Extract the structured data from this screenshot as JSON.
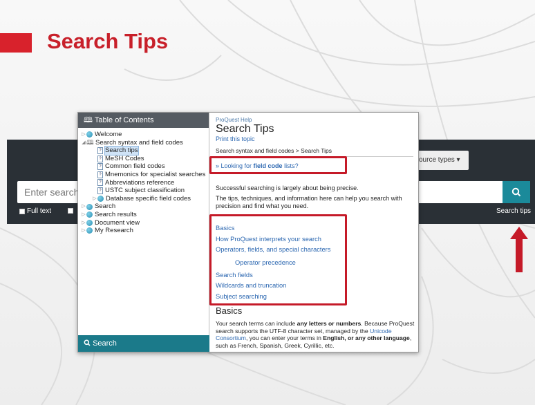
{
  "slide": {
    "title": "Search Tips",
    "accent_color": "#c8202a"
  },
  "background_search": {
    "placeholder": "Enter search",
    "search_icon": "search-icon",
    "source_types_label": "ource types ▾",
    "fulltext_label": "Full text",
    "search_tips_label": "Search tips"
  },
  "help": {
    "toc_header": "Table of Contents",
    "toc_items": [
      {
        "label": "Welcome",
        "icon": "globe-icon",
        "toggle": "▷"
      },
      {
        "label": "Search syntax and field codes",
        "icon": "book-icon",
        "toggle": "◢"
      },
      {
        "label": "Search tips",
        "icon": "page-icon",
        "toggle": ""
      },
      {
        "label": "MeSH Codes",
        "icon": "page-icon",
        "toggle": ""
      },
      {
        "label": "Common field codes",
        "icon": "page-icon",
        "toggle": ""
      },
      {
        "label": "Mnemonics for specialist searches",
        "icon": "page-icon",
        "toggle": ""
      },
      {
        "label": "Abbreviations reference",
        "icon": "page-icon",
        "toggle": ""
      },
      {
        "label": "USTC subject classification",
        "icon": "page-icon",
        "toggle": ""
      },
      {
        "label": "Database specific field codes",
        "icon": "globe-icon",
        "toggle": "▷"
      },
      {
        "label": "Search",
        "icon": "globe-icon",
        "toggle": "▷"
      },
      {
        "label": "Search results",
        "icon": "globe-icon",
        "toggle": "▷"
      },
      {
        "label": "Document view",
        "icon": "globe-icon",
        "toggle": "▷"
      },
      {
        "label": "My Research",
        "icon": "globe-icon",
        "toggle": "▷"
      }
    ],
    "toc_search_label": "Search",
    "content": {
      "overline": "ProQuest Help",
      "title": "Search Tips",
      "print": "Print this topic",
      "breadcrumb": "Search syntax and field codes > Search Tips",
      "looking_prefix": "» Looking for ",
      "looking_bold": "field code",
      "looking_suffix": " lists?",
      "para1": "Successful searching is largely about being precise.",
      "para2": "The tips, techniques, and information here can help you search with precision and find what you need.",
      "links": [
        "Basics",
        "How ProQuest interprets your search",
        "Operators, fields, and special characters",
        "Operator precedence",
        "Search fields",
        "Wildcards and truncation",
        "Subject searching"
      ],
      "basics_heading": "Basics",
      "para3_a": "Your search terms can include ",
      "para3_b": "any letters or numbers",
      "para3_c": ". Because ProQuest search supports the UTF-8 character set, managed by the ",
      "para3_link": "Unicode Consortium",
      "para3_d": ", you can enter your terms in ",
      "para3_e": "English, or any other language",
      "para3_f": ", such as French, Spanish, Greek, Cyrillic, etc."
    }
  }
}
